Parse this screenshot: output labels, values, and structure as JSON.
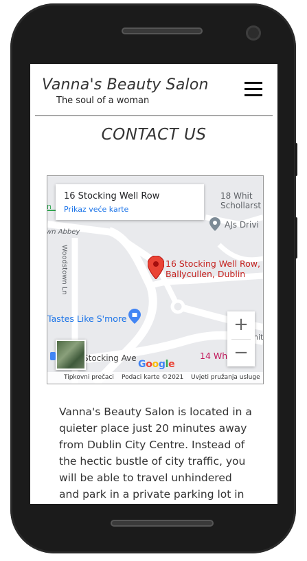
{
  "site": {
    "brand": "Vanna's Beauty Salon",
    "tagline": "The soul of a woman",
    "menu_icon": "hamburger-icon"
  },
  "page": {
    "title": "CONTACT US",
    "paragraph": "Vanna's Beauty Salon is located in a quieter place just 20 minutes away from Dublin City Centre. Instead of the hectic bustle of city traffic, you will be able to travel unhindered and park in a private parking lot in"
  },
  "map": {
    "card_address": "16 Stocking Well Row",
    "card_link": "Prikaz veće karte",
    "marker_label_line1": "16 Stocking Well Row,",
    "marker_label_line2": "Ballycullen, Dublin",
    "labels": {
      "top_right_1": "18 Whit",
      "top_right_2": "Schollarst",
      "ajs": "AJs Drivi",
      "abbey": "wn Abbey",
      "woodstown": "Woodstown Ln",
      "tastes": "Tastes Like S'more",
      "stocking_ave": "Stocking Ave",
      "whit14": "14 Whi",
      "nit": "nit",
      "left_n": "n"
    },
    "google": "Google",
    "footer": {
      "shortcuts": "Tipkovni prečaci",
      "map_data": "Podaci karte ©2021",
      "terms": "Uvjeti pružanja usluge"
    },
    "zoom_in": "+",
    "zoom_out": "−"
  },
  "colors": {
    "pin": "#ea4335",
    "link": "#1a73e8"
  }
}
